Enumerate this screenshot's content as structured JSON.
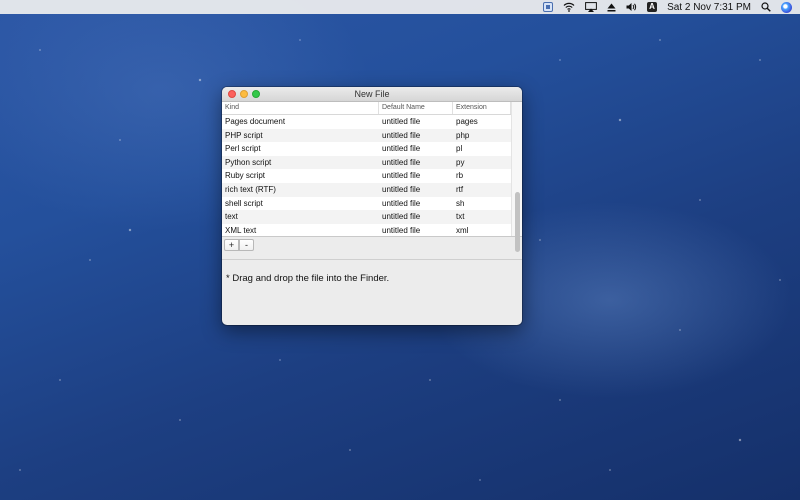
{
  "menubar": {
    "icons": [
      "app-window-icon",
      "wifi-icon",
      "airplay-icon",
      "eject-icon",
      "volume-icon",
      "input-source-icon",
      "spotlight-search-icon",
      "siri-icon"
    ],
    "input_source_label": "A",
    "datetime": "Sat 2 Nov  7:31 PM"
  },
  "window": {
    "title": "New File",
    "columns": {
      "kind": "Kind",
      "default_name": "Default Name",
      "extension": "Extension"
    },
    "rows": [
      {
        "kind": "Pages document",
        "default_name": "untitled file",
        "extension": "pages"
      },
      {
        "kind": "PHP script",
        "default_name": "untitled file",
        "extension": "php"
      },
      {
        "kind": "Perl script",
        "default_name": "untitled file",
        "extension": "pl"
      },
      {
        "kind": "Python script",
        "default_name": "untitled file",
        "extension": "py"
      },
      {
        "kind": "Ruby script",
        "default_name": "untitled file",
        "extension": "rb"
      },
      {
        "kind": "rich text (RTF)",
        "default_name": "untitled file",
        "extension": "rtf"
      },
      {
        "kind": "shell script",
        "default_name": "untitled file",
        "extension": "sh"
      },
      {
        "kind": "text",
        "default_name": "untitled file",
        "extension": "txt"
      },
      {
        "kind": "XML text",
        "default_name": "untitled file",
        "extension": "xml"
      }
    ],
    "add_button_label": "+",
    "remove_button_label": "-",
    "note": "* Drag and drop the file into the Finder."
  },
  "colors": {
    "close": "#fc605c",
    "minimize": "#fdbc40",
    "zoom": "#34c84a",
    "desktop_blue": "#24509c"
  }
}
